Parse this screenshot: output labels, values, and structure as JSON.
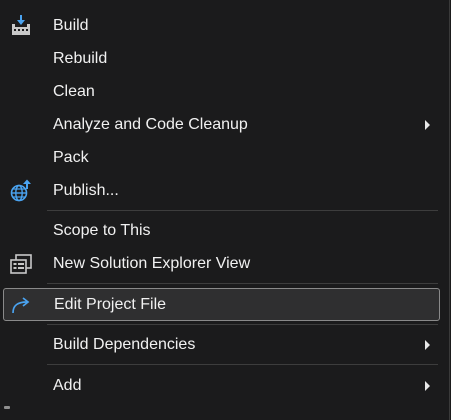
{
  "context_menu": {
    "items": [
      {
        "label": "Build",
        "icon": "build-icon"
      },
      {
        "label": "Rebuild"
      },
      {
        "label": "Clean"
      },
      {
        "label": "Analyze and Code Cleanup",
        "submenu": true
      },
      {
        "label": "Pack"
      },
      {
        "label": "Publish...",
        "icon": "globe-publish-icon"
      },
      {
        "label": "Scope to This"
      },
      {
        "label": "New Solution Explorer View",
        "icon": "solution-explorer-icon"
      },
      {
        "label": "Edit Project File",
        "icon": "edit-redirect-arrow-icon",
        "highlighted": true
      },
      {
        "label": "Build Dependencies",
        "submenu": true
      },
      {
        "label": "Add",
        "submenu": true
      }
    ]
  },
  "colors": {
    "background": "#1b1b1c",
    "text": "#f1f1f1",
    "highlight_border": "#8a8a8a",
    "icon_blue": "#4aa3f0"
  }
}
